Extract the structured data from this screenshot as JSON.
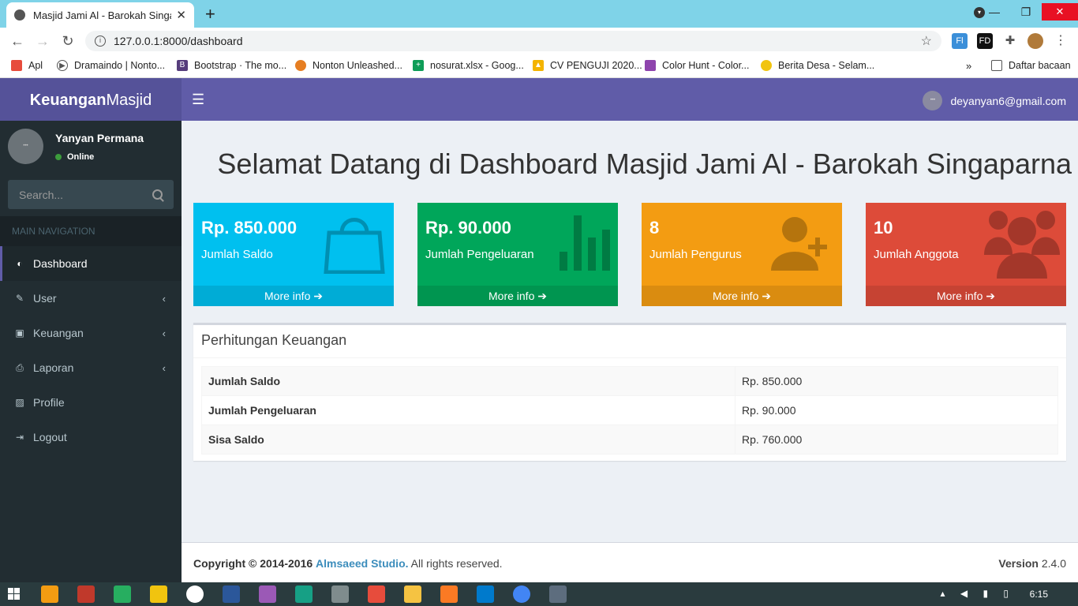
{
  "browser": {
    "tab_title": "Masjid Jami Al - Barokah Singaparna",
    "url": "127.0.0.1:8000/dashboard",
    "bookmarks": [
      "Apl",
      "Dramaindo | Nonto...",
      "Bootstrap · The mo...",
      "Nonton Unleashed...",
      "nosurat.xlsx - Goog...",
      "CV PENGUJI 2020...",
      "Color Hunt - Color...",
      "Berita Desa - Selam..."
    ],
    "reading_list": "Daftar bacaan"
  },
  "header": {
    "logo_bold": "Keuangan",
    "logo_rest": "Masjid",
    "user_email": "deyanyan6@gmail.com"
  },
  "sidebar": {
    "user_name": "Yanyan Permana",
    "status": "Online",
    "search_placeholder": "Search...",
    "nav_header": "MAIN NAVIGATION",
    "items": [
      {
        "label": "Dashboard"
      },
      {
        "label": "User"
      },
      {
        "label": "Keuangan"
      },
      {
        "label": "Laporan"
      },
      {
        "label": "Profile"
      },
      {
        "label": "Logout"
      }
    ]
  },
  "main": {
    "title": "Selamat Datang di Dashboard Masjid Jami Al - Barokah Singaparna",
    "boxes": [
      {
        "value": "Rp. 850.000",
        "label": "Jumlah Saldo",
        "more": "More info",
        "color": "#00c0ef"
      },
      {
        "value": "Rp. 90.000",
        "label": "Jumlah Pengeluaran",
        "more": "More info",
        "color": "#00a65a"
      },
      {
        "value": "8",
        "label": "Jumlah Pengurus",
        "more": "More info",
        "color": "#f39c12"
      },
      {
        "value": "10",
        "label": "Jumlah Anggota",
        "more": "More info",
        "color": "#dd4b39"
      }
    ],
    "panel_title": "Perhitungan Keuangan",
    "table": [
      {
        "label": "Jumlah Saldo",
        "value": "Rp. 850.000"
      },
      {
        "label": "Jumlah Pengeluaran",
        "value": "Rp. 90.000"
      },
      {
        "label": "Sisa Saldo",
        "value": "Rp. 760.000"
      }
    ]
  },
  "footer": {
    "copyright": "Copyright © 2014-2016",
    "company": "Almsaeed Studio.",
    "rights": "All rights reserved.",
    "version_label": "Version",
    "version": "2.4.0"
  },
  "taskbar": {
    "clock": "6:15"
  }
}
